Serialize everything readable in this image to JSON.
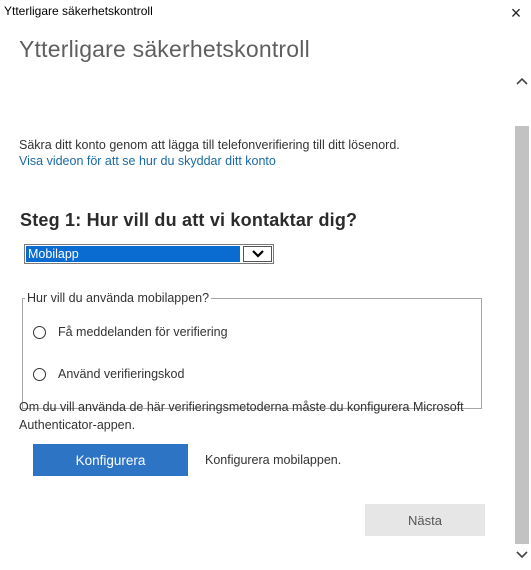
{
  "window": {
    "title": "Ytterligare säkerhetskontroll",
    "close_glyph": "×"
  },
  "page": {
    "title": "Ytterligare säkerhetskontroll",
    "description": "Säkra ditt konto genom att lägga till telefonverifiering till ditt lösenord.",
    "video_link": "Visa videon för att se hur du skyddar ditt konto"
  },
  "step1": {
    "heading": "Steg 1: Hur vill du att vi kontaktar dig?",
    "method_select": {
      "selected": "Mobilapp"
    },
    "usage_group": {
      "legend": "Hur vill du använda mobilappen?",
      "options": [
        {
          "label": "Få meddelanden för verifiering",
          "checked": false
        },
        {
          "label": "Använd verifieringskod",
          "checked": false
        }
      ]
    },
    "info": "Om du vill använda de här verifieringsmetoderna måste du konfigurera Microsoft Authenticator-appen.",
    "configure_button": "Konfigurera",
    "configure_hint": "Konfigurera mobilappen."
  },
  "footer": {
    "next_button": "Nästa"
  },
  "icons": {
    "close": "close-icon",
    "dropdown": "chevron-down-icon",
    "scroll_up": "chevron-up-icon",
    "scroll_down": "chevron-down-icon"
  },
  "colors": {
    "select_highlight": "#0a6cd0",
    "primary_button": "#2e74c5",
    "link": "#1a6aa8",
    "disabled_button": "#e6e6e6"
  }
}
